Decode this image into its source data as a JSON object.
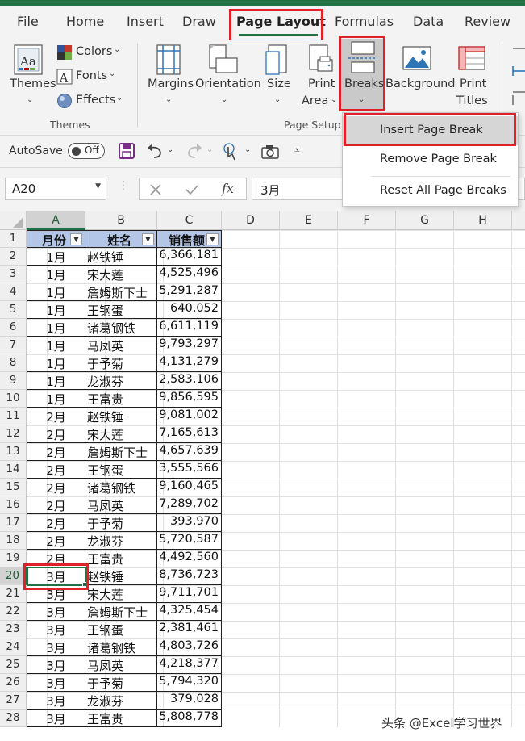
{
  "tabs": [
    {
      "id": "file",
      "label": "File"
    },
    {
      "id": "home",
      "label": "Home"
    },
    {
      "id": "insert",
      "label": "Insert"
    },
    {
      "id": "draw",
      "label": "Draw"
    },
    {
      "id": "page_layout",
      "label": "Page Layout"
    },
    {
      "id": "formulas",
      "label": "Formulas"
    },
    {
      "id": "data",
      "label": "Data"
    },
    {
      "id": "review",
      "label": "Review"
    }
  ],
  "active_tab": "Page Layout",
  "ribbon": {
    "themes": {
      "label": "Themes",
      "colors": "Colors",
      "fonts": "Fonts",
      "effects": "Effects",
      "group": "Themes"
    },
    "page_setup": {
      "margins": "Margins",
      "orientation": "Orientation",
      "size": "Size",
      "print_area_1": "Print",
      "print_area_2": "Area",
      "breaks": "Breaks",
      "background": "Background",
      "print_titles_1": "Print",
      "print_titles_2": "Titles",
      "group": "Page Setup"
    }
  },
  "qat": {
    "autosave_label": "AutoSave",
    "autosave_state": "Off"
  },
  "formula_bar": {
    "name_box": "A20",
    "fx": "fx",
    "value": "3月"
  },
  "breaks_menu": {
    "items": [
      {
        "label": "Insert Page Break",
        "selected": true
      },
      {
        "label": "Remove Page Break",
        "selected": false
      },
      {
        "label": "Reset All Page Breaks",
        "selected": false
      }
    ]
  },
  "sheet": {
    "columns": [
      "A",
      "B",
      "C",
      "D",
      "E",
      "F",
      "G",
      "H"
    ],
    "header_row": {
      "month": "月份",
      "name": "姓名",
      "sales": "销售额"
    },
    "rows": [
      {
        "month": "1月",
        "name": "赵铁锤",
        "sales": "6,366,181"
      },
      {
        "month": "1月",
        "name": "宋大莲",
        "sales": "4,525,496"
      },
      {
        "month": "1月",
        "name": "詹姆斯下士",
        "sales": "5,291,287"
      },
      {
        "month": "1月",
        "name": "王钢蛋",
        "sales": "640,052"
      },
      {
        "month": "1月",
        "name": "诸葛钢铁",
        "sales": "6,611,119"
      },
      {
        "month": "1月",
        "name": "马凤英",
        "sales": "9,793,297"
      },
      {
        "month": "1月",
        "name": "于予菊",
        "sales": "4,131,279"
      },
      {
        "month": "1月",
        "name": "龙淑芬",
        "sales": "2,583,106"
      },
      {
        "month": "1月",
        "name": "王富贵",
        "sales": "9,856,595"
      },
      {
        "month": "2月",
        "name": "赵铁锤",
        "sales": "9,081,002"
      },
      {
        "month": "2月",
        "name": "宋大莲",
        "sales": "7,165,613"
      },
      {
        "month": "2月",
        "name": "詹姆斯下士",
        "sales": "4,657,639"
      },
      {
        "month": "2月",
        "name": "王钢蛋",
        "sales": "3,555,566"
      },
      {
        "month": "2月",
        "name": "诸葛钢铁",
        "sales": "9,160,465"
      },
      {
        "month": "2月",
        "name": "马凤英",
        "sales": "7,289,702"
      },
      {
        "month": "2月",
        "name": "于予菊",
        "sales": "393,970"
      },
      {
        "month": "2月",
        "name": "龙淑芬",
        "sales": "5,720,587"
      },
      {
        "month": "2月",
        "name": "王富贵",
        "sales": "4,492,560"
      },
      {
        "month": "3月",
        "name": "赵铁锤",
        "sales": "8,736,723"
      },
      {
        "month": "3月",
        "name": "宋大莲",
        "sales": "9,711,701"
      },
      {
        "month": "3月",
        "name": "詹姆斯下士",
        "sales": "4,325,454"
      },
      {
        "month": "3月",
        "name": "王钢蛋",
        "sales": "2,381,461"
      },
      {
        "month": "3月",
        "name": "诸葛钢铁",
        "sales": "4,803,726"
      },
      {
        "month": "3月",
        "name": "马凤英",
        "sales": "4,218,377"
      },
      {
        "month": "3月",
        "name": "于予菊",
        "sales": "5,794,320"
      },
      {
        "month": "3月",
        "name": "龙淑芬",
        "sales": "379,028"
      },
      {
        "month": "3月",
        "name": "王富贵",
        "sales": "5,808,778"
      }
    ],
    "row_numbers": [
      "1",
      "2",
      "3",
      "4",
      "5",
      "6",
      "7",
      "8",
      "9",
      "10",
      "11",
      "12",
      "13",
      "14",
      "15",
      "16",
      "17",
      "18",
      "19",
      "20",
      "21",
      "22",
      "23",
      "24",
      "25",
      "26",
      "27",
      "28"
    ],
    "active_cell": "A20"
  },
  "watermark": "头条 @Excel学习世界",
  "colors": {
    "accent": "#217346",
    "highlight": "#e0202a",
    "header_fill": "#b4c6e7"
  }
}
